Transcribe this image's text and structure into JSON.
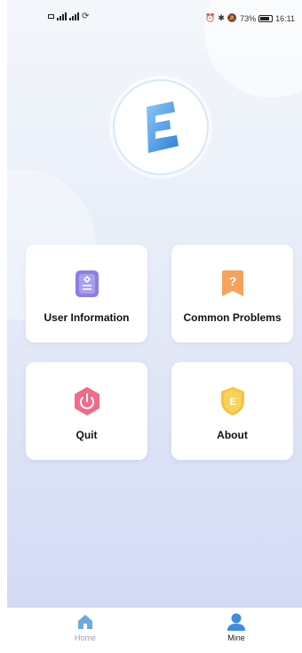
{
  "status_bar": {
    "left_text": "46 46",
    "battery_text": "73%",
    "time": "16:11"
  },
  "logo": {
    "icon": "app-logo-e-icon"
  },
  "menu": [
    {
      "label": "User Information",
      "icon": "user-info-icon",
      "color": "#8b7fe3"
    },
    {
      "label": "Common Problems",
      "icon": "question-icon",
      "color": "#f5a25d"
    },
    {
      "label": "Quit",
      "icon": "power-icon",
      "color": "#f06b86"
    },
    {
      "label": "About",
      "icon": "shield-e-icon",
      "color": "#f6c33a"
    }
  ],
  "bottom_nav": [
    {
      "label": "Home",
      "icon": "home-icon",
      "active": false
    },
    {
      "label": "Mine",
      "icon": "person-icon",
      "active": true
    }
  ],
  "colors": {
    "accent": "#3d8de0",
    "inactive": "#9aa3b5",
    "active_text": "#222222"
  }
}
